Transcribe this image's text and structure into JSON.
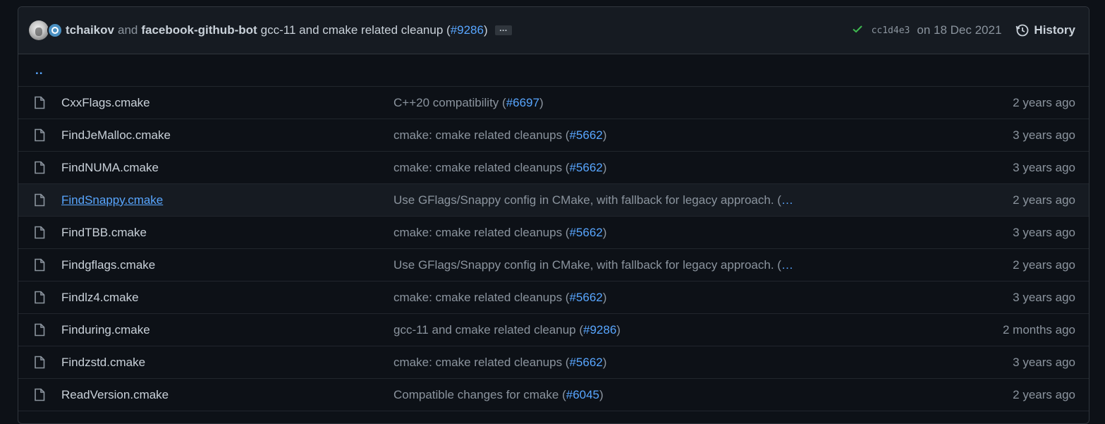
{
  "commit": {
    "author1": "tchaikov",
    "and_text": "and",
    "author2": "facebook-github-bot",
    "message": "gcc-11 and cmake related cleanup (",
    "pr": "#9286",
    "close_paren": ")",
    "ellipsis": "…",
    "sha": "cc1d4e3",
    "date": "on 18 Dec 2021",
    "history_label": "History",
    "status_icon": "check-icon",
    "status_color": "#3fb950"
  },
  "parent_dir": "..",
  "files": [
    {
      "name": "CxxFlags.cmake",
      "msg": "C++20 compatibility (",
      "pr": "#6697",
      "tail": ")",
      "age": "2 years ago"
    },
    {
      "name": "FindJeMalloc.cmake",
      "msg": "cmake: cmake related cleanups (",
      "pr": "#5662",
      "tail": ")",
      "age": "3 years ago"
    },
    {
      "name": "FindNUMA.cmake",
      "msg": "cmake: cmake related cleanups (",
      "pr": "#5662",
      "tail": ")",
      "age": "3 years ago"
    },
    {
      "name": "FindSnappy.cmake",
      "msg": "Use GFlags/Snappy config in CMake, with fallback for legacy approach. (",
      "pr": "…",
      "tail": "",
      "age": "2 years ago"
    },
    {
      "name": "FindTBB.cmake",
      "msg": "cmake: cmake related cleanups (",
      "pr": "#5662",
      "tail": ")",
      "age": "3 years ago"
    },
    {
      "name": "Findgflags.cmake",
      "msg": "Use GFlags/Snappy config in CMake, with fallback for legacy approach. (",
      "pr": "…",
      "tail": "",
      "age": "2 years ago"
    },
    {
      "name": "Findlz4.cmake",
      "msg": "cmake: cmake related cleanups (",
      "pr": "#5662",
      "tail": ")",
      "age": "3 years ago"
    },
    {
      "name": "Finduring.cmake",
      "msg": "gcc-11 and cmake related cleanup (",
      "pr": "#9286",
      "tail": ")",
      "age": "2 months ago"
    },
    {
      "name": "Findzstd.cmake",
      "msg": "cmake: cmake related cleanups (",
      "pr": "#5662",
      "tail": ")",
      "age": "3 years ago"
    },
    {
      "name": "ReadVersion.cmake",
      "msg": "Compatible changes for cmake (",
      "pr": "#6045",
      "tail": ")",
      "age": "2 years ago"
    }
  ],
  "icons": {
    "file": "file-icon",
    "history": "history-icon"
  },
  "colors": {
    "link": "#58a6ff",
    "muted": "#8b949e",
    "background": "#0d1117",
    "header": "#161b22"
  }
}
